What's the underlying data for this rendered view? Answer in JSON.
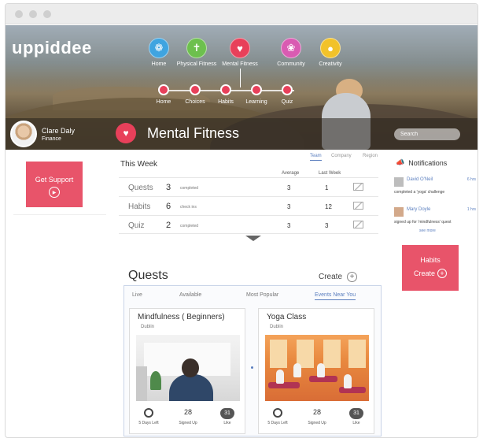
{
  "brand": {
    "logo_text": "uppiddee",
    "accent": "#e8405a"
  },
  "main_nav": [
    {
      "label": "Home",
      "color": "#3fa4e0",
      "icon": "running-person-icon"
    },
    {
      "label": "Physical Fitness",
      "color": "#6dc04e",
      "icon": "standing-person-icon"
    },
    {
      "label": "Mental Fitness",
      "color": "#e8405a",
      "icon": "heart-icon"
    },
    {
      "label": "Community",
      "color": "#d95bb2",
      "icon": "lotus-icon"
    },
    {
      "label": "Creativity",
      "color": "#f2c22a",
      "icon": "head-icon"
    }
  ],
  "sub_nav": [
    {
      "label": "Home"
    },
    {
      "label": "Choices"
    },
    {
      "label": "Habits"
    },
    {
      "label": "Learning"
    },
    {
      "label": "Quiz"
    }
  ],
  "profile": {
    "name": "Clare Daly",
    "department": "Finance"
  },
  "page": {
    "title": "Mental Fitness",
    "icon": "heart-icon"
  },
  "search": {
    "placeholder": "Search"
  },
  "support": {
    "label": "Get Support",
    "icon": "play-icon"
  },
  "week": {
    "title": "This Week",
    "filters": [
      "Team",
      "Company",
      "Region"
    ],
    "active_filter": "Team",
    "columns": {
      "average": "Average",
      "last_week": "Last Week"
    },
    "rows": [
      {
        "label": "Quests",
        "value": "3",
        "unit": "completed",
        "average": "3",
        "last_week": "1"
      },
      {
        "label": "Habits",
        "value": "6",
        "unit": "check ins",
        "average": "3",
        "last_week": "12"
      },
      {
        "label": "Quiz",
        "value": "2",
        "unit": "completed",
        "average": "3",
        "last_week": "3"
      }
    ]
  },
  "notifications": {
    "title": "Notifications",
    "items": [
      {
        "name": "David O'Neil",
        "time": "6 hrs",
        "text": "completed a 'yoga' challenge"
      },
      {
        "name": "Mary Doyle",
        "time": "1 hrs",
        "text": "signed up for 'mindfulness' quest"
      }
    ],
    "see_more": "see more"
  },
  "habits_card": {
    "title": "Habits",
    "create_label": "Create"
  },
  "quests": {
    "title": "Quests",
    "create_label": "Create",
    "tabs": [
      "Live",
      "Available",
      "Most Popular",
      "Events Near You"
    ],
    "active_tab": "Events Near You",
    "cards": [
      {
        "title": "Mindfulness ( Beginners)",
        "location": "Dublin",
        "days_left": "5 Days Left",
        "signed_up_count": "28",
        "signed_up_label": "Signed Up",
        "likes": "31",
        "like_label": "Like"
      },
      {
        "title": "Yoga Class",
        "location": "Dublin",
        "days_left": "5 Days Left",
        "signed_up_count": "28",
        "signed_up_label": "Signed Up",
        "likes": "31",
        "like_label": "Like"
      }
    ]
  }
}
